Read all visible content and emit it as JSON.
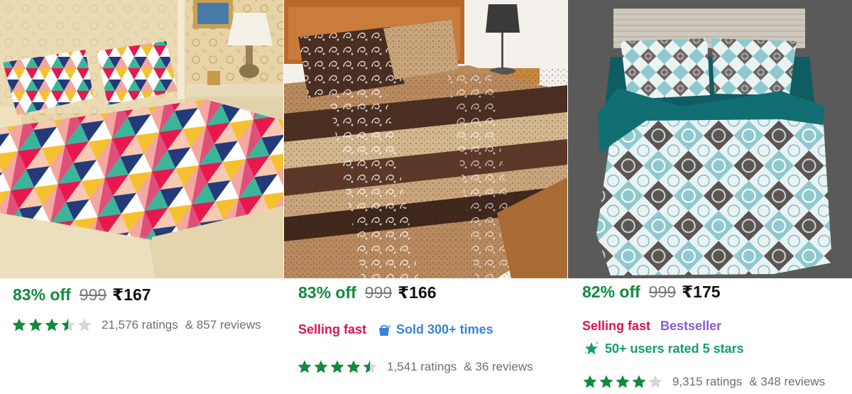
{
  "products": [
    {
      "discount": "83% off",
      "mrp": "999",
      "price": "₹167",
      "rating": 3.5,
      "ratings_text": "21,576 ratings",
      "reviews_text": "& 857 reviews"
    },
    {
      "discount": "83% off",
      "mrp": "999",
      "price": "₹166",
      "badge_1": "Selling fast",
      "badge_2": "Sold 300+ times",
      "rating": 4.5,
      "ratings_text": "1,541 ratings",
      "reviews_text": "& 36 reviews"
    },
    {
      "discount": "82% off",
      "mrp": "999",
      "price": "₹175",
      "badge_1": "Selling fast",
      "badge_2": "Bestseller",
      "rated_text": "50+ users rated 5 stars",
      "rating": 4,
      "ratings_text": "9,315 ratings",
      "reviews_text": "& 348 reviews"
    }
  ],
  "colors": {
    "discount": "#118a3f",
    "star": "#118a3f",
    "star_empty": "#d6d6d6",
    "selling_fast": "#e0124f",
    "sold": "#3b82d6",
    "bestseller": "#8a5bd6",
    "rated": "#12a06a"
  },
  "icons": {
    "sold": "shopping-bag-icon",
    "rated": "sparkle-star-icon"
  }
}
